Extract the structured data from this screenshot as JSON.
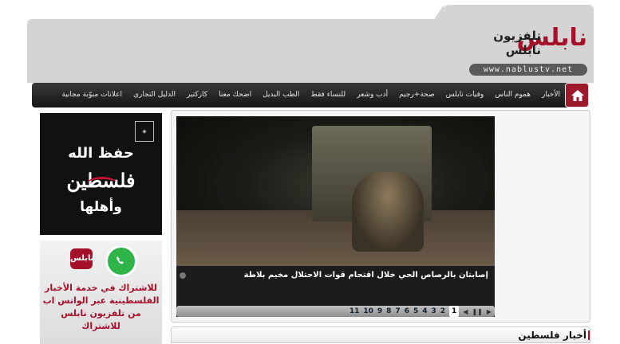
{
  "header": {
    "logo_line1": "نابلس",
    "logo_line2": "تلفزيون",
    "logo_line3": "نابلس",
    "logo_url": "www.nablustv.net"
  },
  "nav": {
    "items": [
      {
        "label": "الأخبار"
      },
      {
        "label": "هموم الناس"
      },
      {
        "label": "وفيات نابلس"
      },
      {
        "label": "صحة+رجيم"
      },
      {
        "label": "أدب وشعر"
      },
      {
        "label": "للنساء فقط"
      },
      {
        "label": "الطب البديل"
      },
      {
        "label": "اضحك معنا"
      },
      {
        "label": "كاركتير"
      },
      {
        "label": "الدليل التجاري"
      },
      {
        "label": "اعلانات مبوّبة مجانية"
      }
    ]
  },
  "sidebar": {
    "banner1": {
      "line1": "حفظ الله",
      "line2": "فلسطين",
      "line3": "وأهلها"
    },
    "banner2": {
      "logo_text": "نابلس",
      "line1": "للاشتراك في خدمة الأخبار",
      "line2": "الفلسطينية عبر الواتس اب",
      "line3": "من تلفزيون نابلس",
      "line4": "للاشتراك"
    }
  },
  "slider": {
    "caption": "إصابتان بالرصاص الحي خلال اقتحام قوات الاحتلال مخيم بلاطة",
    "pages": [
      "1",
      "2",
      "3",
      "4",
      "5",
      "6",
      "7",
      "8",
      "9",
      "10",
      "11"
    ],
    "active_page": "1"
  },
  "section": {
    "title": "أخبار فلسطين"
  },
  "colors": {
    "brand_red": "#a6112a",
    "nav_bg": "#1e1e1e",
    "header_bg": "#d4d4d4"
  }
}
